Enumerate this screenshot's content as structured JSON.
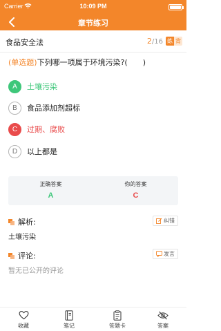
{
  "status_bar": {
    "carrier": "Carrier",
    "time": "10:09 PM",
    "wifi_icon": "wifi-icon",
    "battery_icon": "battery-icon"
  },
  "nav": {
    "title": "章节练习",
    "back_icon": "chevron-left-icon"
  },
  "subject": {
    "name": "食品安全法",
    "current": "2",
    "total": "/16",
    "mode_practice": "练",
    "mode_recite": "背"
  },
  "question": {
    "type": "(单选题)",
    "text": "下列哪一项属于环境污染?(　　)"
  },
  "options": [
    {
      "letter": "A",
      "text": "土壤污染",
      "state": "correct"
    },
    {
      "letter": "B",
      "text": "食品添加剂超标",
      "state": "normal"
    },
    {
      "letter": "C",
      "text": "过期、腐败",
      "state": "wrong"
    },
    {
      "letter": "D",
      "text": "以上都是",
      "state": "normal"
    }
  ],
  "answer": {
    "correct_label": "正确答案",
    "correct_value": "A",
    "mine_label": "你的答案",
    "mine_value": "C"
  },
  "analysis": {
    "title": "解析:",
    "content": "土壤污染",
    "error_button": "纠错"
  },
  "comments": {
    "title": "评论:",
    "empty_text": "暂无已公开的评论",
    "post_button": "发言"
  },
  "tabs": [
    {
      "label": "收藏",
      "icon": "heart-icon"
    },
    {
      "label": "笔记",
      "icon": "notebook-icon"
    },
    {
      "label": "答题卡",
      "icon": "clipboard-icon"
    },
    {
      "label": "答案",
      "icon": "eye-slash-icon"
    }
  ],
  "colors": {
    "accent": "#f3862a",
    "correct": "#3ec77a",
    "wrong": "#e94b4b"
  }
}
